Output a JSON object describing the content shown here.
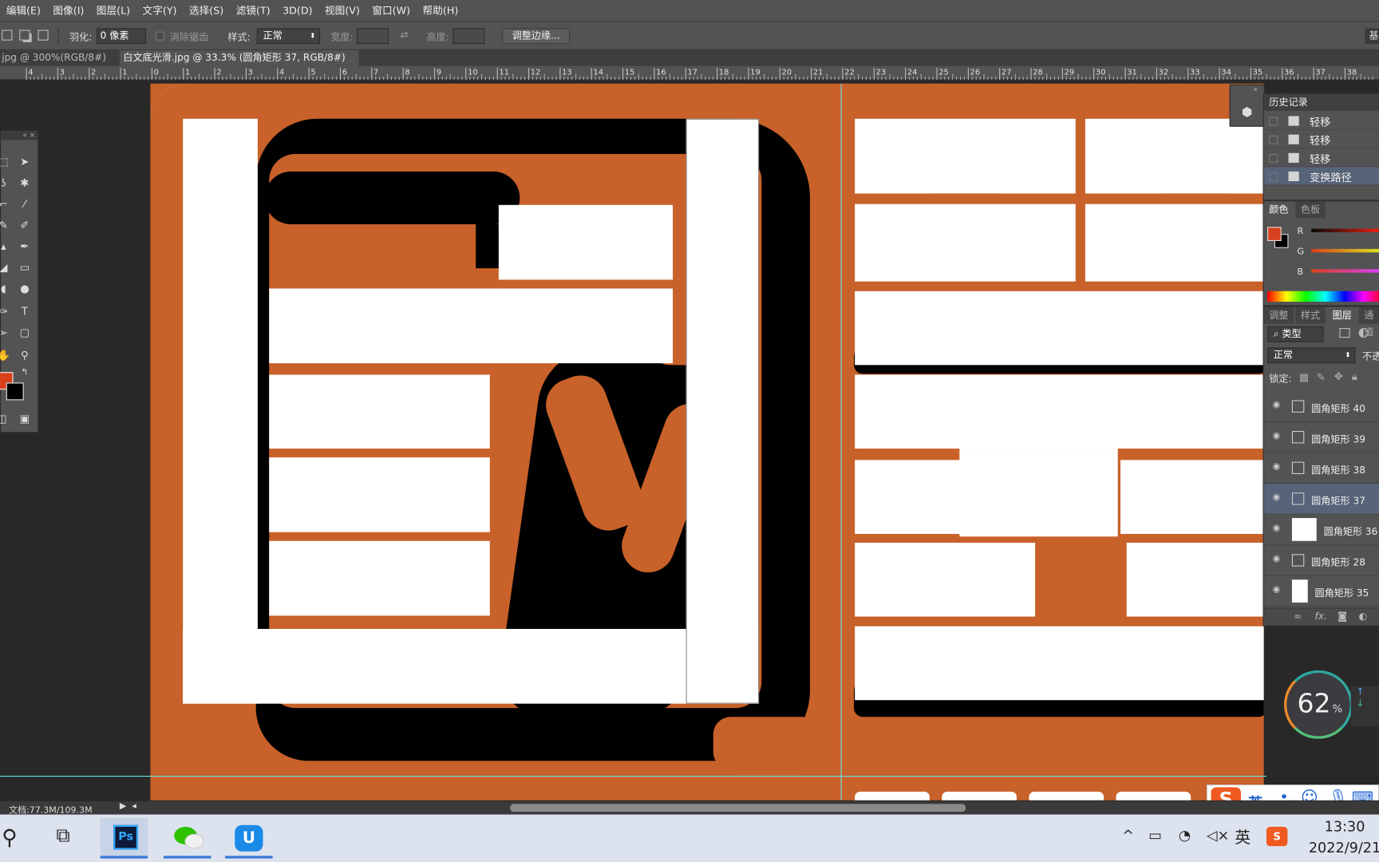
{
  "menubar": [
    "编辑(E)",
    "图像(I)",
    "图层(L)",
    "文字(Y)",
    "选择(S)",
    "滤镜(T)",
    "3D(D)",
    "视图(V)",
    "窗口(W)",
    "帮助(H)"
  ],
  "options": {
    "feather_label": "羽化:",
    "feather_value": "0 像素",
    "antialias_label": "消除锯齿",
    "style_label": "样式:",
    "style_value": "正常",
    "width_label": "宽度:",
    "height_label": "高度:",
    "refine_label": "调整边缘...",
    "right_btn": "基"
  },
  "tabs": {
    "tab1": "jpg @ 300%(RGB/8#) *",
    "tab2": "白文底光滑.jpg @ 33.3% (圆角矩形 37, RGB/8#) *"
  },
  "ruler": [
    "4",
    "3",
    "2",
    "1",
    "0",
    "1",
    "2",
    "3",
    "4",
    "5",
    "6",
    "7",
    "8",
    "9",
    "10",
    "11",
    "12",
    "13",
    "14",
    "15",
    "16",
    "17",
    "18",
    "19",
    "20",
    "21",
    "22",
    "23",
    "24",
    "25",
    "26",
    "27",
    "28",
    "29",
    "30",
    "31",
    "32",
    "33",
    "34",
    "35",
    "36",
    "37",
    "38"
  ],
  "history": {
    "title": "历史记录",
    "items": [
      "轻移",
      "轻移",
      "轻移",
      "变换路径"
    ]
  },
  "color_panel": {
    "tabs": [
      "颜色",
      "色板"
    ],
    "channels": [
      "R",
      "G",
      "B"
    ],
    "fg": "#d8401c",
    "bg": "#000000"
  },
  "layers_panel": {
    "tabs": [
      "调整",
      "样式",
      "图层",
      "通道"
    ],
    "filter": "类型",
    "blend": "正常",
    "opacity_label": "不透",
    "lock_label": "锁定:",
    "layers": [
      "圆角矩形 40",
      "圆角矩形 39",
      "圆角矩形 38",
      "圆角矩形 37",
      "圆角矩形 36",
      "圆角矩形 28",
      "圆角矩形 35"
    ]
  },
  "status": {
    "doc": "文档:77.3M/109.3M"
  },
  "speed_widget": {
    "value": "62",
    "unit": "%"
  },
  "ime": {
    "lang": "英"
  },
  "taskbar": {
    "time": "13:30",
    "date": "2022/9/21",
    "tray_lang": "英"
  },
  "colors": {
    "canvas_orange": "#c8612a",
    "panel": "#535353",
    "accent_selected": "#566378"
  }
}
